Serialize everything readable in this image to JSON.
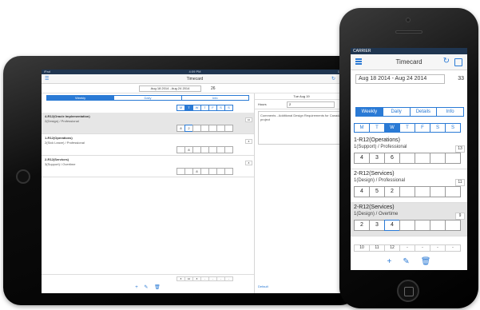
{
  "ipad": {
    "status": {
      "carrier": "iPad",
      "time": "4:09 PM",
      "battery": "100%"
    },
    "nav": {
      "title": "Timecard"
    },
    "date_range": "Aug 18 2014 - Aug 24 2014",
    "week_total": "26",
    "tabs": [
      "Weekly",
      "Daily",
      "Info"
    ],
    "days": [
      "M",
      "T",
      "W",
      "T",
      "F",
      "S",
      "S"
    ],
    "tasks": [
      {
        "name": "4-R12(Oracle Implementation)",
        "detail": "2(Design) / Professional",
        "total": "10",
        "cells": [
          "8",
          "2",
          "",
          "",
          "",
          "",
          ""
        ]
      },
      {
        "name": "1-R12(Operations)",
        "detail": "2(Sick Leave) / Professional",
        "total": "8",
        "cells": [
          "",
          "8",
          "",
          "",
          "",
          "",
          ""
        ]
      },
      {
        "name": "2-R12(Services)",
        "detail": "3(Support) / Overtime",
        "total": "8",
        "cells": [
          "",
          "",
          "8",
          "",
          "",
          "",
          ""
        ]
      }
    ],
    "sums": [
      "8",
      "10",
      "8",
      "-",
      "-",
      "-",
      "-"
    ],
    "detail": {
      "date": "Tue Aug 19",
      "hours_label": "Hours",
      "hours_value": "2",
      "comment": "Comments - Additional Design Requirements for Canada project",
      "default_label": "Default"
    }
  },
  "iphone": {
    "status": {
      "carrier": "CARRIER"
    },
    "nav": {
      "title": "Timecard"
    },
    "date_range": "Aug 18 2014 - Aug 24 2014",
    "week_total": "33",
    "tabs": [
      "Weekly",
      "Daily",
      "Details",
      "Info"
    ],
    "days": [
      "M",
      "T",
      "W",
      "T",
      "F",
      "S",
      "S"
    ],
    "tasks": [
      {
        "name": "1-R12(Operations)",
        "detail": "1(Support) / Professional",
        "total": "13",
        "cells": [
          "4",
          "3",
          "6",
          "",
          "",
          "",
          ""
        ]
      },
      {
        "name": "2-R12(Services)",
        "detail": "1(Design) / Professional",
        "total": "11",
        "cells": [
          "4",
          "5",
          "2",
          "",
          "",
          "",
          ""
        ]
      },
      {
        "name": "2-R12(Services)",
        "detail": "1(Design) / Overtime",
        "total": "9",
        "cells": [
          "2",
          "3",
          "4",
          "",
          "",
          "",
          ""
        ]
      }
    ],
    "sums": [
      "10",
      "11",
      "12",
      "-",
      "-",
      "-",
      "-"
    ]
  },
  "colors": {
    "accent": "#2a7ad5",
    "status_bar": "#1f3550",
    "selected_row": "#e4e4e4"
  },
  "icons": {
    "menu": "menu-icon",
    "refresh": "refresh-icon",
    "save": "save-icon",
    "add": "plus-icon",
    "edit": "pencil-icon",
    "delete": "trash-icon"
  }
}
